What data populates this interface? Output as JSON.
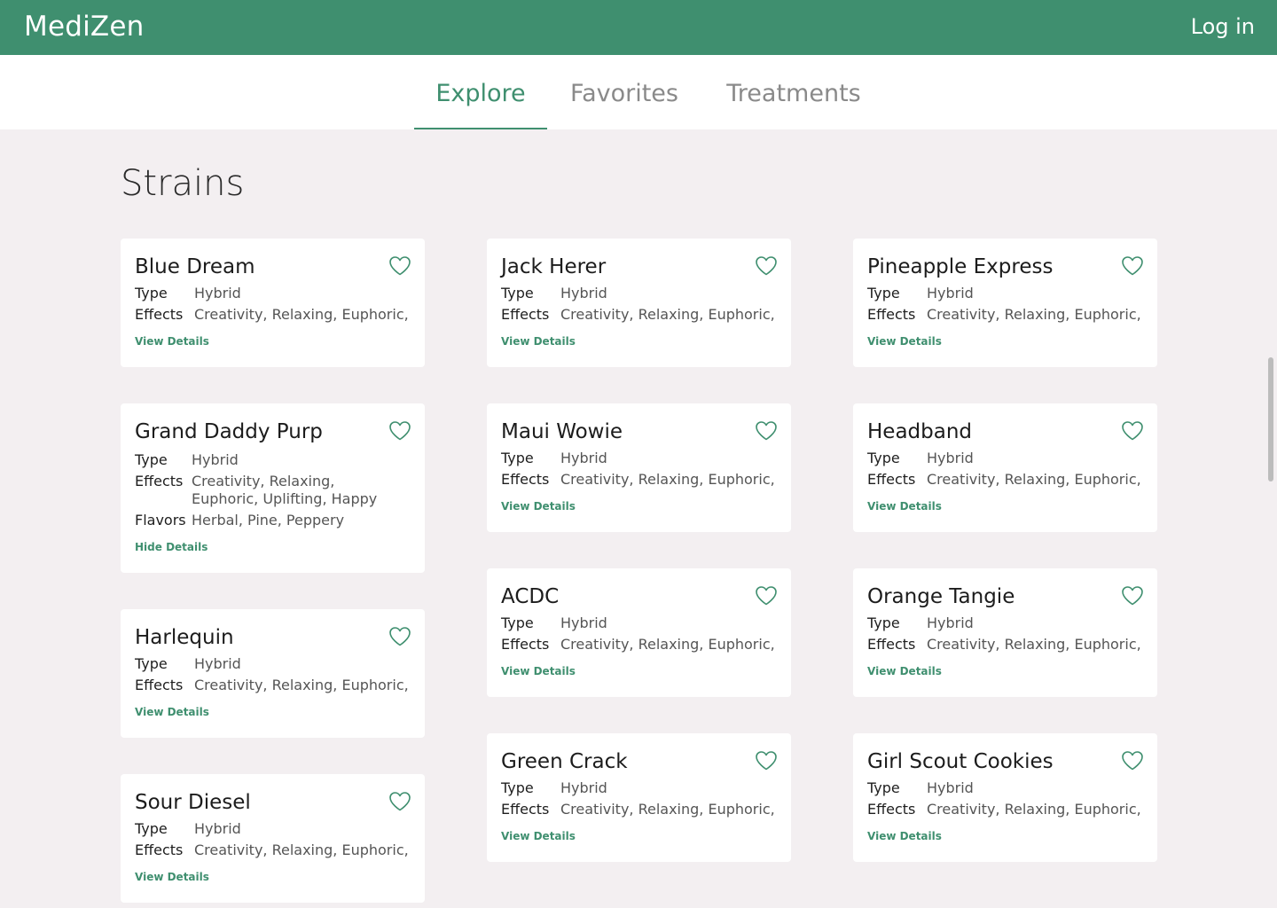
{
  "header": {
    "brand": "MediZen",
    "login_label": "Log in"
  },
  "tabs": [
    {
      "label": "Explore",
      "active": true
    },
    {
      "label": "Favorites",
      "active": false
    },
    {
      "label": "Treatments",
      "active": false
    }
  ],
  "page_title": "Strains",
  "labels": {
    "type": "Type",
    "effects": "Effects",
    "flavors": "Flavors",
    "view": "View Details",
    "hide": "Hide Details"
  },
  "strains": [
    {
      "name": "Blue Dream",
      "type": "Hybrid",
      "effects": "Creativity, Relaxing, Euphoric,"
    },
    {
      "name": "Grand Daddy Purp",
      "type": "Hybrid",
      "effects": "Creativity, Relaxing, Euphoric, Uplifting, Happy",
      "flavors": "Herbal, Pine, Peppery",
      "expanded": true
    },
    {
      "name": "Harlequin",
      "type": "Hybrid",
      "effects": "Creativity, Relaxing, Euphoric,"
    },
    {
      "name": "Sour Diesel",
      "type": "Hybrid",
      "effects": "Creativity, Relaxing, Euphoric,"
    },
    {
      "name": "Jack Herer",
      "type": "Hybrid",
      "effects": "Creativity, Relaxing, Euphoric,"
    },
    {
      "name": "Maui Wowie",
      "type": "Hybrid",
      "effects": "Creativity, Relaxing, Euphoric,"
    },
    {
      "name": "ACDC",
      "type": "Hybrid",
      "effects": "Creativity, Relaxing, Euphoric,"
    },
    {
      "name": "Green Crack",
      "type": "Hybrid",
      "effects": "Creativity, Relaxing, Euphoric,"
    },
    {
      "name": "Pineapple Express",
      "type": "Hybrid",
      "effects": "Creativity, Relaxing, Euphoric,"
    },
    {
      "name": "Headband",
      "type": "Hybrid",
      "effects": "Creativity, Relaxing, Euphoric,"
    },
    {
      "name": "Orange Tangie",
      "type": "Hybrid",
      "effects": "Creativity, Relaxing, Euphoric,"
    },
    {
      "name": "Girl Scout Cookies",
      "type": "Hybrid",
      "effects": "Creativity, Relaxing, Euphoric,"
    }
  ],
  "icons": {
    "favorite": "heart-outline-icon"
  },
  "colors": {
    "brand": "#3f8f6f",
    "background": "#f3eff1"
  }
}
